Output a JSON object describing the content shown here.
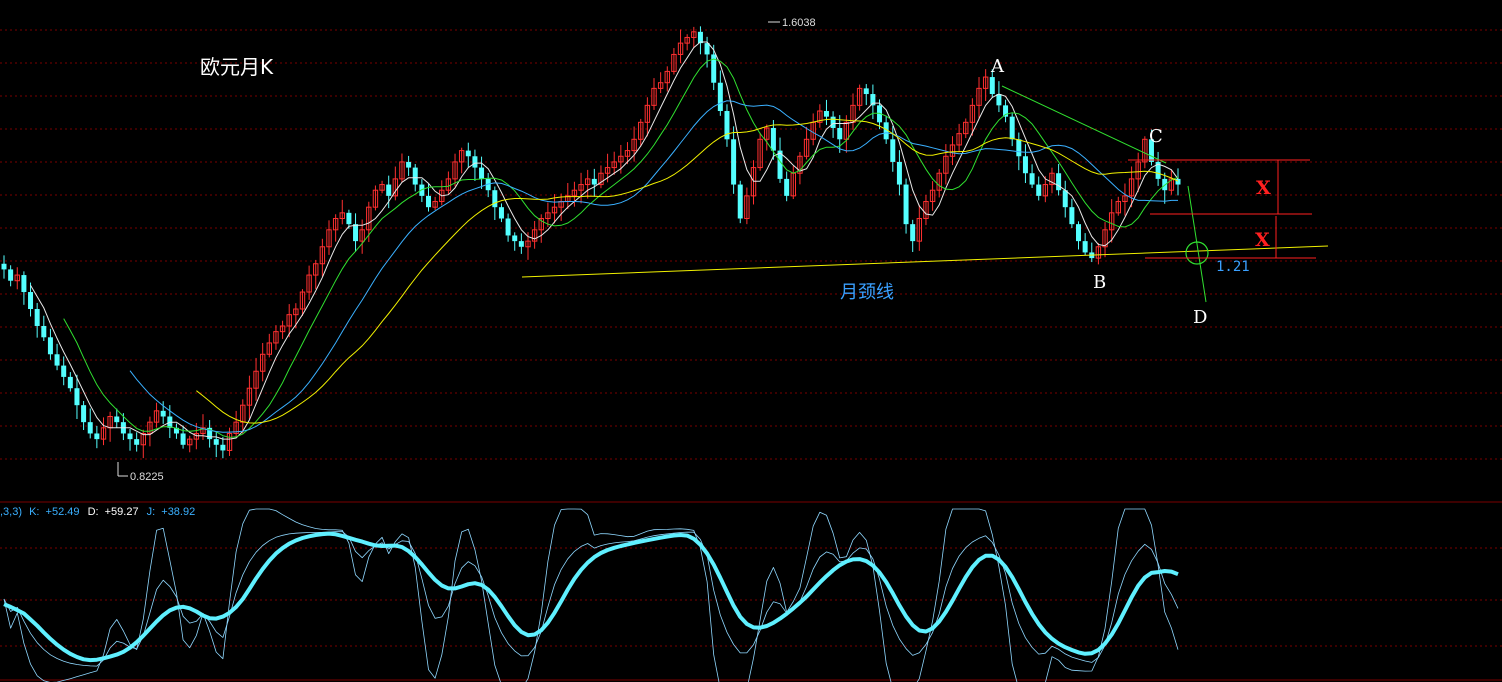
{
  "colors": {
    "background": "#000000",
    "grid": "#7a0000",
    "up_candle": "#ff3030",
    "down_candle": "#54ffff",
    "ma_white": "#e8e8e8",
    "ma_yellow": "#f0f000",
    "ma_green": "#30e030",
    "ma_blue": "#3ab0ff",
    "kdj_thick": "#5ff0ff",
    "kdj_thin": "#8fd8ff",
    "marker_red": "#ff2020",
    "label_blue": "#3aa0ff"
  },
  "labels": {
    "title": "欧元月K",
    "neckline": "月颈线",
    "high_price": "1.6038",
    "low_price": "0.8225",
    "point_a": "A",
    "point_b": "B",
    "point_c": "C",
    "point_d": "D",
    "x_mark": "X",
    "target": "1.21"
  },
  "indicator": {
    "params": ",3,3)",
    "k_label": "K:",
    "k_value": "+52.49",
    "d_label": "D:",
    "d_value": "+59.27",
    "j_label": "J:",
    "j_value": "+38.92"
  },
  "chart_data": [
    {
      "type": "candlestick",
      "title": "欧元月K",
      "period": "monthly",
      "price_range_visible": [
        0.82,
        1.61
      ],
      "extremes": {
        "high": 1.6038,
        "low": 0.8225
      },
      "key_points": {
        "A": 1.51,
        "B": 1.19,
        "C": 1.4,
        "D": 1.1
      },
      "neckline_label": "月颈线",
      "target_level": 1.21,
      "close_series": [
        1.17,
        1.15,
        1.16,
        1.13,
        1.1,
        1.07,
        1.05,
        1.02,
        1.0,
        0.98,
        0.96,
        0.93,
        0.9,
        0.88,
        0.87,
        0.89,
        0.91,
        0.9,
        0.88,
        0.87,
        0.86,
        0.88,
        0.9,
        0.92,
        0.91,
        0.89,
        0.88,
        0.86,
        0.87,
        0.88,
        0.89,
        0.87,
        0.86,
        0.85,
        0.88,
        0.9,
        0.93,
        0.96,
        0.99,
        1.02,
        1.04,
        1.06,
        1.07,
        1.09,
        1.1,
        1.13,
        1.16,
        1.18,
        1.21,
        1.24,
        1.26,
        1.27,
        1.25,
        1.22,
        1.24,
        1.28,
        1.31,
        1.32,
        1.3,
        1.33,
        1.36,
        1.35,
        1.32,
        1.3,
        1.28,
        1.29,
        1.31,
        1.33,
        1.36,
        1.38,
        1.37,
        1.35,
        1.33,
        1.31,
        1.28,
        1.26,
        1.23,
        1.22,
        1.21,
        1.22,
        1.24,
        1.26,
        1.27,
        1.28,
        1.29,
        1.3,
        1.31,
        1.32,
        1.33,
        1.32,
        1.34,
        1.35,
        1.36,
        1.37,
        1.38,
        1.4,
        1.43,
        1.46,
        1.49,
        1.5,
        1.52,
        1.55,
        1.57,
        1.58,
        1.59,
        1.57,
        1.55,
        1.5,
        1.45,
        1.4,
        1.32,
        1.26,
        1.3,
        1.35,
        1.4,
        1.42,
        1.38,
        1.33,
        1.3,
        1.34,
        1.37,
        1.4,
        1.43,
        1.45,
        1.44,
        1.42,
        1.4,
        1.43,
        1.46,
        1.49,
        1.48,
        1.46,
        1.43,
        1.4,
        1.36,
        1.32,
        1.25,
        1.22,
        1.26,
        1.29,
        1.31,
        1.34,
        1.37,
        1.39,
        1.41,
        1.43,
        1.46,
        1.49,
        1.51,
        1.48,
        1.46,
        1.44,
        1.4,
        1.37,
        1.34,
        1.32,
        1.3,
        1.32,
        1.34,
        1.31,
        1.28,
        1.25,
        1.22,
        1.2,
        1.19,
        1.21,
        1.24,
        1.27,
        1.29,
        1.3,
        1.33,
        1.36,
        1.4,
        1.36,
        1.33,
        1.31,
        1.33,
        1.32
      ],
      "kdj": {
        "K": 52.49,
        "D": 59.27,
        "J": 38.92
      }
    }
  ]
}
